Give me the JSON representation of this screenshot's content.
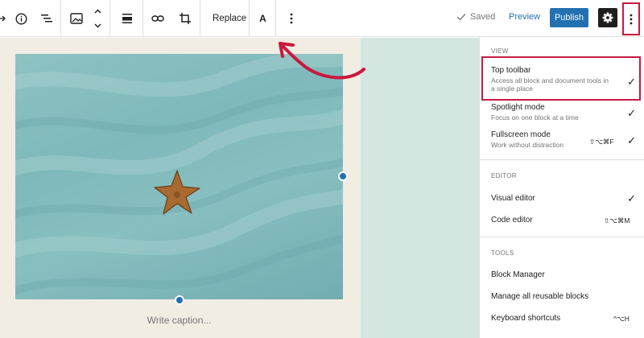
{
  "toolbar": {
    "replace_label": "Replace",
    "text_color_label": "A",
    "saved_label": "Saved",
    "preview_label": "Preview",
    "publish_label": "Publish"
  },
  "canvas": {
    "caption_placeholder": "Write caption..."
  },
  "options_menu": {
    "view": {
      "title": "VIEW",
      "items": [
        {
          "label": "Top toolbar",
          "description": "Access all block and document tools in a single place",
          "checked": true
        },
        {
          "label": "Spotlight mode",
          "description": "Focus on one block at a time",
          "checked": true
        },
        {
          "label": "Fullscreen mode",
          "description": "Work without distraction",
          "shortcut": "⇧⌥⌘F",
          "checked": true
        }
      ]
    },
    "editor": {
      "title": "EDITOR",
      "items": [
        {
          "label": "Visual editor",
          "checked": true
        },
        {
          "label": "Code editor",
          "shortcut": "⇧⌥⌘M"
        }
      ]
    },
    "tools": {
      "title": "TOOLS",
      "items": [
        {
          "label": "Block Manager"
        },
        {
          "label": "Manage all reusable blocks"
        },
        {
          "label": "Keyboard shortcuts",
          "shortcut": "^⌥H"
        }
      ]
    }
  },
  "colors": {
    "accent_blue": "#2271b1",
    "annotation_red": "#c9193f",
    "canvas_beige": "#f2ede3",
    "canvas_teal": "#d3e6e0"
  }
}
